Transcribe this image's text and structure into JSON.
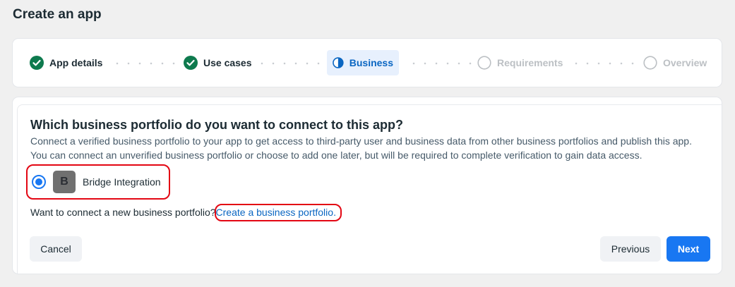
{
  "page": {
    "title": "Create an app"
  },
  "stepper": {
    "steps": [
      {
        "label": "App details",
        "state": "complete"
      },
      {
        "label": "Use cases",
        "state": "complete"
      },
      {
        "label": "Business",
        "state": "active"
      },
      {
        "label": "Requirements",
        "state": "pending"
      },
      {
        "label": "Overview",
        "state": "pending"
      }
    ]
  },
  "main": {
    "question": "Which business portfolio do you want to connect to this app?",
    "description_line1": "Connect a verified business portfolio to your app to get access to third-party user and business data from other business portfolios and publish this app.",
    "description_line2": "You can connect an unverified business portfolio or choose to add one later, but will be required to complete verification to gain data access.",
    "portfolio": {
      "avatar_letter": "B",
      "name": "Bridge Integration",
      "selected": true
    },
    "new_portfolio_prompt": "Want to connect a new business portfolio?",
    "create_link": "Create a business portfolio."
  },
  "buttons": {
    "cancel": "Cancel",
    "previous": "Previous",
    "next": "Next"
  },
  "colors": {
    "complete": "#0e7a4e",
    "accent": "#1877f2",
    "highlight": "#e30613"
  }
}
